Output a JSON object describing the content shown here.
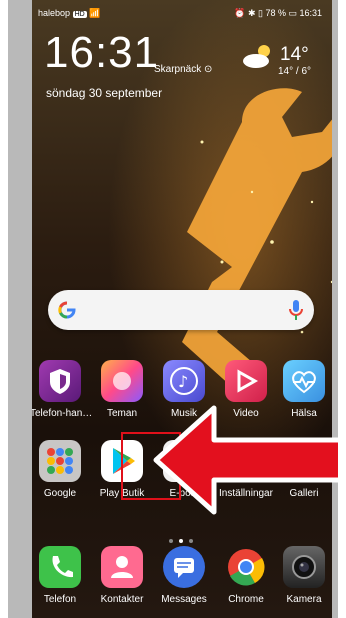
{
  "status": {
    "carrier": "halebop",
    "badge": "HD",
    "right": "⏰ ✱ ▯ 78 % ▭ 16:31"
  },
  "lockwidget": {
    "time": "16:31",
    "location": "Skarpnäck",
    "date": "söndag 30 september",
    "temp": "14°",
    "temp_range": "14° / 6°"
  },
  "apps_row1": [
    {
      "label": "Telefon-han…",
      "icon": "shield-icon",
      "color": "#7a2a8e"
    },
    {
      "label": "Teman",
      "icon": "themes-icon",
      "color": "#ff5a7a"
    },
    {
      "label": "Musik",
      "icon": "music-icon",
      "color": "#6a6ae8"
    },
    {
      "label": "Video",
      "icon": "video-icon",
      "color": "#f03a6a"
    },
    {
      "label": "Hälsa",
      "icon": "health-icon",
      "color": "#4ab0f0"
    }
  ],
  "apps_row2": [
    {
      "label": "Google",
      "icon": "google-folder-icon",
      "color": "#ddd"
    },
    {
      "label": "Play Butik",
      "icon": "play-store-icon",
      "color": "#ffffff"
    },
    {
      "label": "E-post",
      "icon": "email-icon",
      "color": "#eeeeee"
    },
    {
      "label": "Inställningar",
      "icon": "settings-icon",
      "color": "#9a9a9a"
    },
    {
      "label": "Galleri",
      "icon": "gallery-icon",
      "color": "#ffffff"
    }
  ],
  "dock": [
    {
      "label": "Telefon",
      "icon": "phone-icon",
      "color": "#3ec24a"
    },
    {
      "label": "Kontakter",
      "icon": "contacts-icon",
      "color": "#ff6a90"
    },
    {
      "label": "Messages",
      "icon": "messages-icon",
      "color": "#3a6ee0"
    },
    {
      "label": "Chrome",
      "icon": "chrome-icon",
      "color": "#ffffff"
    },
    {
      "label": "Kamera",
      "icon": "camera-icon",
      "color": "#333333"
    }
  ]
}
